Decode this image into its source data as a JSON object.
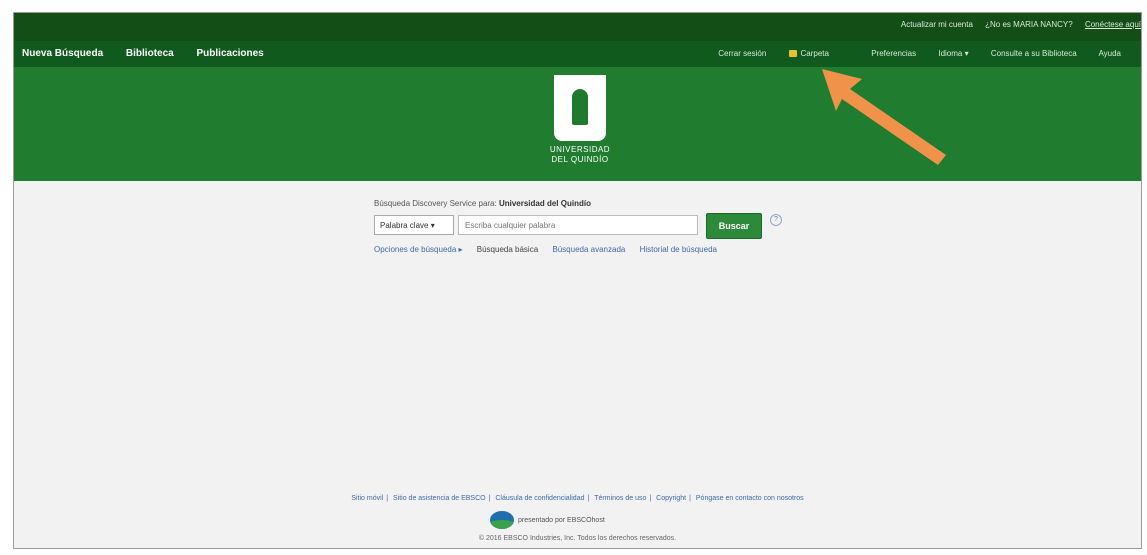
{
  "topbar": {
    "update_account": "Actualizar mi cuenta",
    "not_user": "¿No es MARIA NANCY?",
    "login_here": "Conéctese aquí"
  },
  "nav": {
    "left": [
      "Nueva Búsqueda",
      "Biblioteca",
      "Publicaciones"
    ],
    "right": {
      "close_session": "Cerrar sesión",
      "folder": "Carpeta",
      "preferences": "Preferencias",
      "language": "Idioma ▾",
      "ask_library": "Consulte a su Biblioteca",
      "help": "Ayuda"
    }
  },
  "logo": {
    "line1": "UNIVERSIDAD",
    "line2": "DEL QUINDÍO"
  },
  "search": {
    "caption_prefix": "Búsqueda Discovery Service para: ",
    "caption_org": "Universidad del Quindío",
    "keyword_select": "Palabra clave ▾",
    "placeholder": "Escriba cualquier palabra",
    "button": "Buscar",
    "help": "?",
    "links": {
      "options": "Opciones de búsqueda ▸",
      "basic": "Búsqueda básica",
      "advanced": "Búsqueda avanzada",
      "history": "Historial de búsqueda"
    }
  },
  "footer": {
    "links": [
      "Sitio móvil",
      "Sitio de asistencia de EBSCO",
      "Cláusula de confidencialidad",
      "Términos de uso",
      "Copyright",
      "Póngase en contacto con nosotros"
    ],
    "powered_by": "presentado por EBSCOhost",
    "copyright": "© 2016 EBSCO Industries, Inc. Todos los derechos reservados."
  },
  "colors": {
    "topbar": "#134e16",
    "navbar": "#0f5a1c",
    "banner": "#207c2f",
    "button": "#2c8a3a",
    "arrow": "#f0924a"
  }
}
